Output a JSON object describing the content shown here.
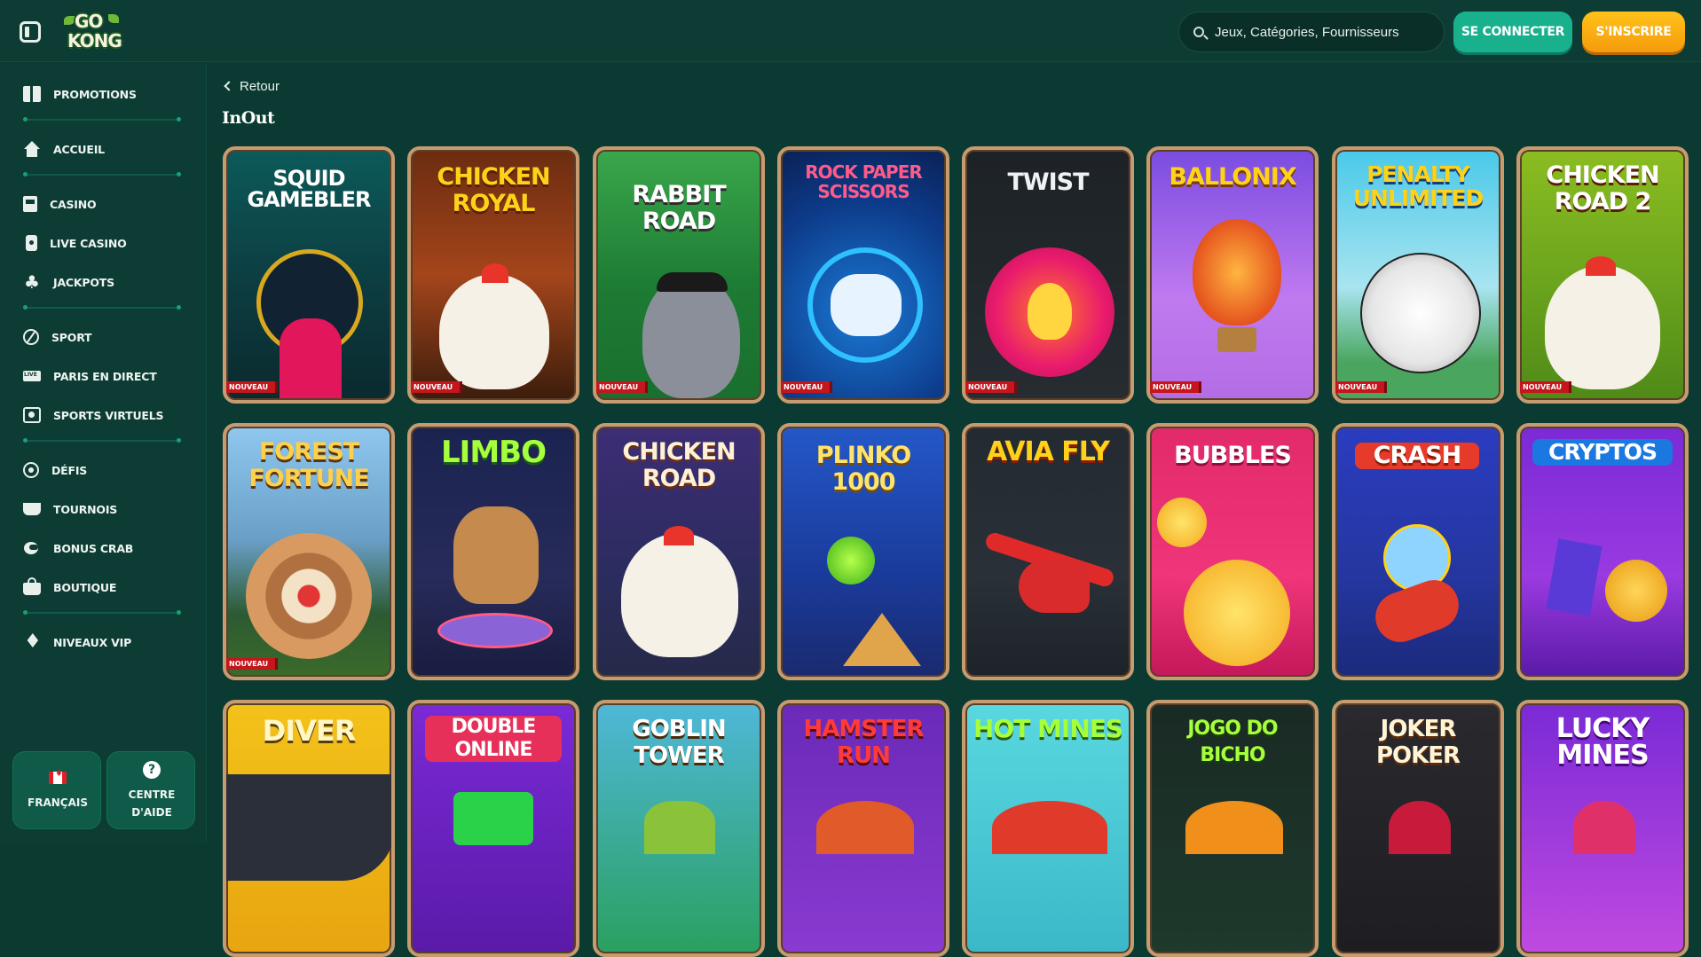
{
  "header": {
    "search_placeholder": "Jeux, Catégories, Fournisseurs",
    "login_label": "SE CONNECTER",
    "signup_label": "S'INSCRIRE",
    "logo_line1": "GO",
    "logo_line2": "KONG"
  },
  "sidebar": {
    "items": [
      {
        "label": "PROMOTIONS"
      },
      {
        "label": "ACCUEIL"
      },
      {
        "label": "CASINO"
      },
      {
        "label": "LIVE CASINO"
      },
      {
        "label": "JACKPOTS"
      },
      {
        "label": "SPORT"
      },
      {
        "label": "PARIS EN DIRECT"
      },
      {
        "label": "SPORTS VIRTUELS"
      },
      {
        "label": "DÉFIS"
      },
      {
        "label": "TOURNOIS"
      },
      {
        "label": "BONUS CRAB"
      },
      {
        "label": "BOUTIQUE"
      },
      {
        "label": "NIVEAUX VIP"
      }
    ],
    "language_label": "FRANÇAIS",
    "help_label": "CENTRE D'AIDE"
  },
  "main": {
    "back_label": "Retour",
    "title": "InOut",
    "badge_label": "NOUVEAU",
    "games": [
      {
        "name": "SQUID GAMEBLER",
        "new": true
      },
      {
        "name": "CHICKEN ROYAL",
        "new": true
      },
      {
        "name": "RABBIT ROAD",
        "new": true
      },
      {
        "name": "ROCK PAPER SCISSORS",
        "new": true
      },
      {
        "name": "TWIST",
        "new": true
      },
      {
        "name": "BALLONIX",
        "new": true
      },
      {
        "name": "PENALTY UNLIMITED",
        "new": true
      },
      {
        "name": "CHICKEN ROAD 2",
        "new": true
      },
      {
        "name": "FOREST FORTUNE",
        "new": true
      },
      {
        "name": "LIMBO",
        "new": false
      },
      {
        "name": "CHICKEN ROAD",
        "new": false
      },
      {
        "name": "PLINKO 1000",
        "new": false
      },
      {
        "name": "AVIA FLY",
        "new": false
      },
      {
        "name": "BUBBLES",
        "new": false
      },
      {
        "name": "CRASH",
        "new": false
      },
      {
        "name": "CRYPTOS",
        "new": false
      },
      {
        "name": "DIVER",
        "new": false
      },
      {
        "name": "DOUBLE ONLINE",
        "new": false
      },
      {
        "name": "GOBLIN TOWER",
        "new": false
      },
      {
        "name": "HAMSTER RUN",
        "new": false
      },
      {
        "name": "HOT MINES",
        "new": false
      },
      {
        "name": "JOGO DO BICHO",
        "new": false
      },
      {
        "name": "JOKER POKER",
        "new": false
      },
      {
        "name": "LUCKY MINES",
        "new": false
      }
    ]
  },
  "colors": {
    "background": "#0b3a31",
    "accent_green": "#19b08e",
    "accent_orange": "#f59b0b",
    "card_border": "#c79b70",
    "badge_red": "#c4161c"
  }
}
